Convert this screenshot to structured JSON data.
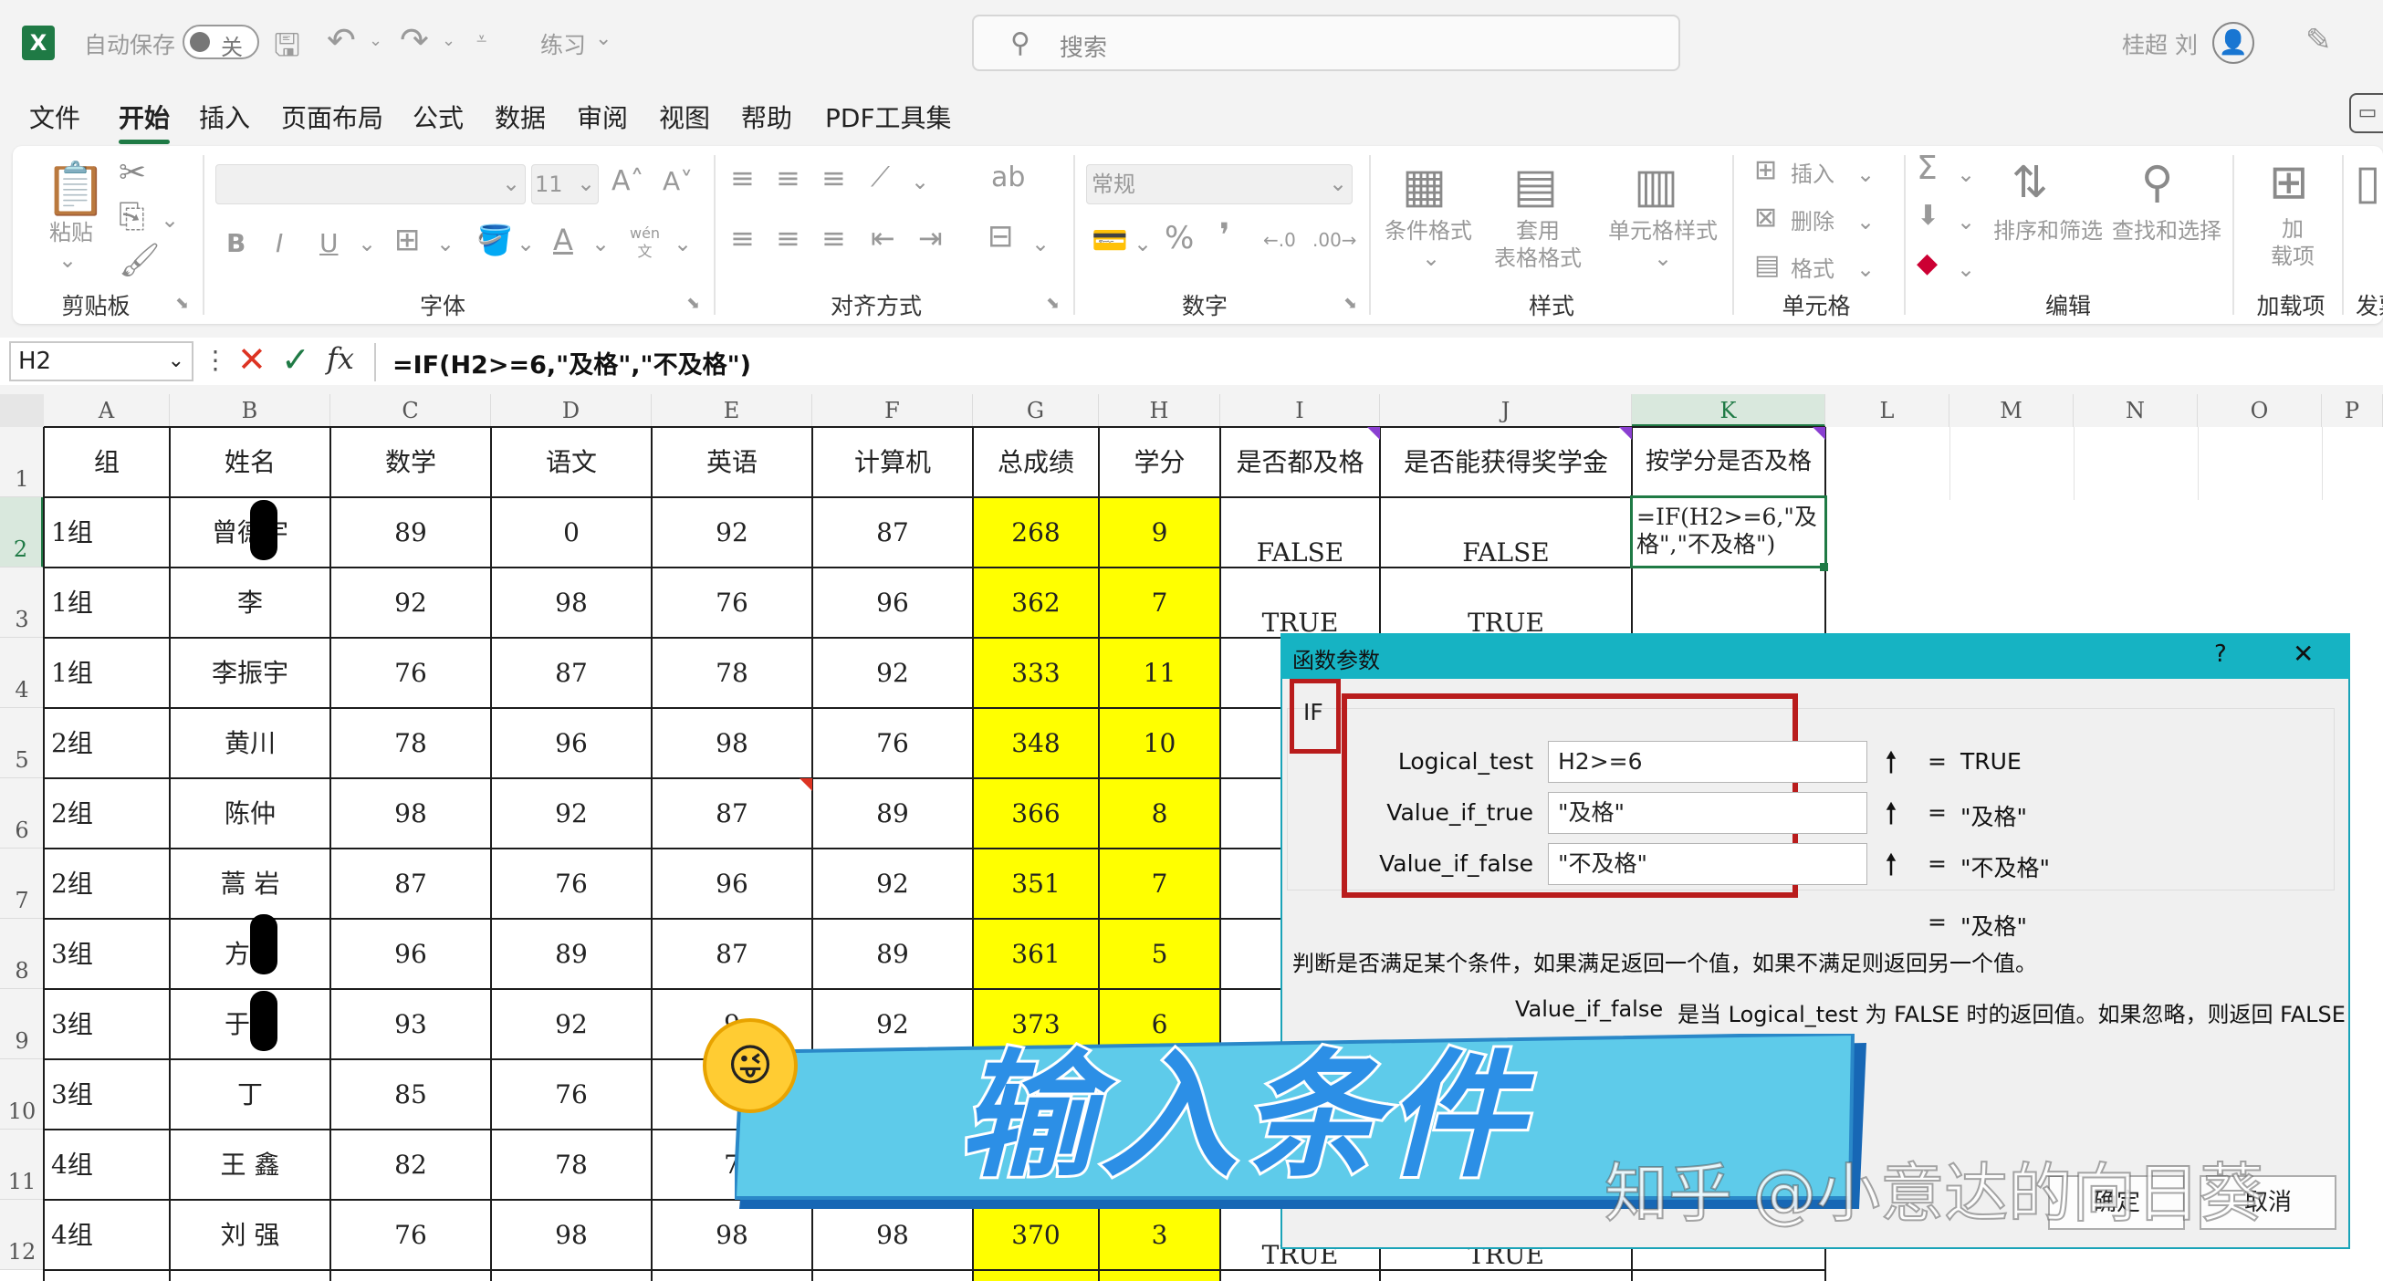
{
  "titlebar": {
    "autosave_label": "自动保存",
    "autosave_state": "关",
    "filename": "练习",
    "search_placeholder": "搜索",
    "user_name": "桂超 刘"
  },
  "menus": [
    "文件",
    "开始",
    "插入",
    "页面布局",
    "公式",
    "数据",
    "审阅",
    "视图",
    "帮助",
    "PDF工具集"
  ],
  "ribbon": {
    "groups": {
      "clipboard": "剪贴板",
      "font": "字体",
      "align": "对齐方式",
      "number": "数字",
      "styles": "样式",
      "cells": "单元格",
      "editing": "编辑",
      "addins": "加载项",
      "share": "发票"
    },
    "paste": "粘贴",
    "font_size": "11",
    "number_format": "常规",
    "cond_format": "条件格式",
    "table_format": "套用\n表格格式",
    "cell_style": "单元格样式",
    "insert": "插入",
    "delete": "删除",
    "format": "格式",
    "sort_filter": "排序和筛选",
    "find_select": "查找和选择",
    "addin": "加\n载项",
    "wen": "wén\n文"
  },
  "formula_bar": {
    "cell_ref": "H2",
    "fx": "fx",
    "formula": "=IF(H2>=6,\"及格\",\"不及格\")"
  },
  "columns": [
    "A",
    "B",
    "C",
    "D",
    "E",
    "F",
    "G",
    "H",
    "I",
    "J",
    "K",
    "L",
    "M",
    "N",
    "O",
    "P"
  ],
  "headers": [
    "组",
    "姓名",
    "数学",
    "语文",
    "英语",
    "计算机",
    "总成绩",
    "学分",
    "是否都及格",
    "是否能获得奖学金",
    "按学分是否及格"
  ],
  "rows": [
    {
      "n": "2",
      "group": "1组",
      "name": "曾德宇",
      "math": "89",
      "chinese": "0",
      "english": "92",
      "computer": "87",
      "total": "268",
      "credit": "9",
      "pass_all": "FALSE",
      "scholarship": "FALSE"
    },
    {
      "n": "3",
      "group": "1组",
      "name": "李",
      "math": "92",
      "chinese": "98",
      "english": "76",
      "computer": "96",
      "total": "362",
      "credit": "7",
      "pass_all": "TRUE",
      "scholarship": "TRUE"
    },
    {
      "n": "4",
      "group": "1组",
      "name": "李振宇",
      "math": "76",
      "chinese": "87",
      "english": "78",
      "computer": "92",
      "total": "333",
      "credit": "11",
      "pass_all": "",
      "scholarship": ""
    },
    {
      "n": "5",
      "group": "2组",
      "name": "黄川",
      "math": "78",
      "chinese": "96",
      "english": "98",
      "computer": "76",
      "total": "348",
      "credit": "10",
      "pass_all": "",
      "scholarship": ""
    },
    {
      "n": "6",
      "group": "2组",
      "name": "陈仲",
      "math": "98",
      "chinese": "92",
      "english": "87",
      "computer": "89",
      "total": "366",
      "credit": "8",
      "pass_all": "",
      "scholarship": ""
    },
    {
      "n": "7",
      "group": "2组",
      "name": "蒿 岩",
      "math": "87",
      "chinese": "76",
      "english": "96",
      "computer": "92",
      "total": "351",
      "credit": "7",
      "pass_all": "",
      "scholarship": ""
    },
    {
      "n": "8",
      "group": "3组",
      "name": "方帅",
      "math": "96",
      "chinese": "89",
      "english": "87",
      "computer": "89",
      "total": "361",
      "credit": "5",
      "pass_all": "",
      "scholarship": ""
    },
    {
      "n": "9",
      "group": "3组",
      "name": "于双",
      "math": "93",
      "chinese": "92",
      "english": "9",
      "computer": "92",
      "total": "373",
      "credit": "6",
      "pass_all": "",
      "scholarship": ""
    },
    {
      "n": "10",
      "group": "3组",
      "name": "丁",
      "math": "85",
      "chinese": "76",
      "english": "",
      "computer": "",
      "total": "",
      "credit": "",
      "pass_all": "",
      "scholarship": ""
    },
    {
      "n": "11",
      "group": "4组",
      "name": "王 鑫",
      "math": "82",
      "chinese": "78",
      "english": "7",
      "computer": "",
      "total": "",
      "credit": "",
      "pass_all": "",
      "scholarship": ""
    },
    {
      "n": "12",
      "group": "4组",
      "name": "刘 强",
      "math": "76",
      "chinese": "98",
      "english": "98",
      "computer": "98",
      "total": "370",
      "credit": "3",
      "pass_all": "TRUE",
      "scholarship": "TRUE"
    }
  ],
  "k2_editing": "=IF(H2>=6,\"及\n格\",\"不及格\")",
  "row1_label": "1",
  "dialog": {
    "title": "函数参数",
    "help": "?",
    "close": "✕",
    "func": "IF",
    "args": [
      {
        "label": "Logical_test",
        "value": "H2>=6",
        "result": "TRUE"
      },
      {
        "label": "Value_if_true",
        "value": "\"及格\"",
        "result": "\"及格\""
      },
      {
        "label": "Value_if_false",
        "value": "\"不及格\"",
        "result": "\"不及格\""
      }
    ],
    "eq": "=",
    "overall_result": "\"及格\"",
    "description": "判断是否满足某个条件，如果满足返回一个值，如果不满足则返回另一个值。",
    "param_name": "Value_if_false",
    "param_desc": "是当 Logical_test 为 FALSE 时的返回值。如果忽略，则返回 FALSE",
    "ok": "确定",
    "cancel": "取消"
  },
  "overlay": {
    "banner_text": "输入条件",
    "watermark": "知乎 @小意达的向日葵"
  },
  "colors": {
    "accent": "#1f7a45",
    "yellow": "#ffff00",
    "dialog_title": "#16b3c3",
    "highlight": "#b91c1c",
    "banner": "#5ecbea"
  }
}
